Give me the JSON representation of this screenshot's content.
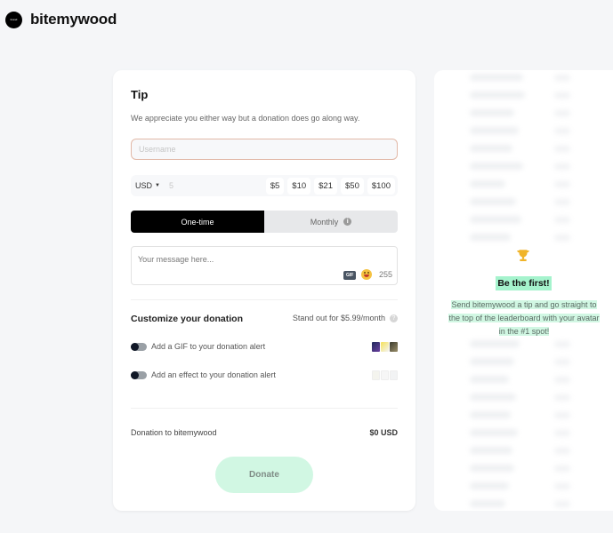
{
  "header": {
    "avatar_text": "brand",
    "creator_name": "bitemywood"
  },
  "tip_card": {
    "title": "Tip",
    "subtitle": "We appreciate you either way but a donation does go along way.",
    "username_placeholder": "Username",
    "currency": "USD",
    "amount_placeholder": "5",
    "presets": [
      "$5",
      "$10",
      "$21",
      "$50",
      "$100"
    ],
    "frequency": {
      "one_time_label": "One-time",
      "monthly_label": "Monthly",
      "selected": "One-time"
    },
    "message_placeholder": "Your message here...",
    "gif_label": "GIF",
    "char_count": "255",
    "customize_title": "Customize your donation",
    "standout_label": "Stand out for $5.99/month",
    "options": [
      {
        "label": "Add a GIF to your donation alert",
        "enabled": false
      },
      {
        "label": "Add an effect to your donation alert",
        "enabled": false
      }
    ],
    "total_label": "Donation to bitemywood",
    "total_value": "$0 USD",
    "donate_label": "Donate"
  },
  "leaderboard": {
    "empty_title": "Be the first!",
    "empty_message": "Send bitemywood a tip and go straight to the top of the leaderboard with your avatar in the #1 spot!"
  },
  "colors": {
    "accent_green": "#a5f3cd",
    "donate_bg": "#d1f7e3",
    "trophy": "#f0b429"
  }
}
